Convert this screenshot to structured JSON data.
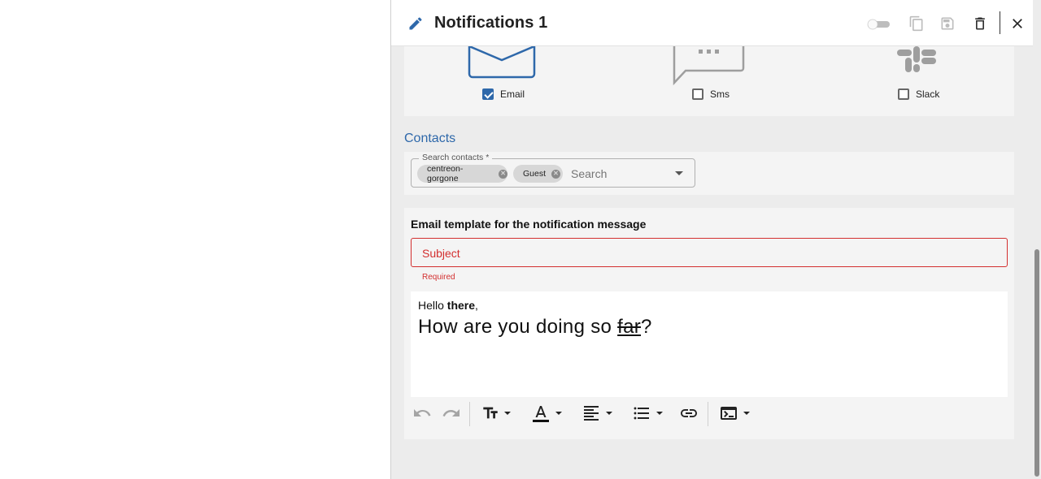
{
  "header": {
    "title": "Notifications 1",
    "icons": [
      "pencil-icon",
      "toggle-switch",
      "duplicate-icon",
      "save-icon",
      "delete-icon",
      "close-icon"
    ]
  },
  "channels": [
    {
      "label": "Email",
      "checked": true,
      "icon": "envelope-icon"
    },
    {
      "label": "Sms",
      "checked": false,
      "icon": "chat-bubble-icon"
    },
    {
      "label": "Slack",
      "checked": false,
      "icon": "slack-icon"
    }
  ],
  "contacts": {
    "title": "Contacts",
    "field_label": "Search contacts *",
    "chips": [
      "centreon-gorgone",
      "Guest"
    ],
    "placeholder": "Search"
  },
  "template": {
    "title": "Email template for the notification message",
    "subject_placeholder": "Subject",
    "error": "Required",
    "body_line1_prefix": "Hello ",
    "body_line1_bold": "there",
    "body_line1_suffix": ",",
    "body_line2_prefix": "How are you doing so ",
    "body_line2_strike": "far",
    "body_line2_suffix": "?"
  },
  "toolbar": [
    "undo-icon",
    "redo-icon",
    "text-size-icon",
    "font-color-icon",
    "align-icon",
    "list-icon",
    "link-icon",
    "code-block-icon"
  ],
  "colors": {
    "accent": "#2e68aa",
    "error": "#d32f2f",
    "panel_bg": "#ececec"
  }
}
